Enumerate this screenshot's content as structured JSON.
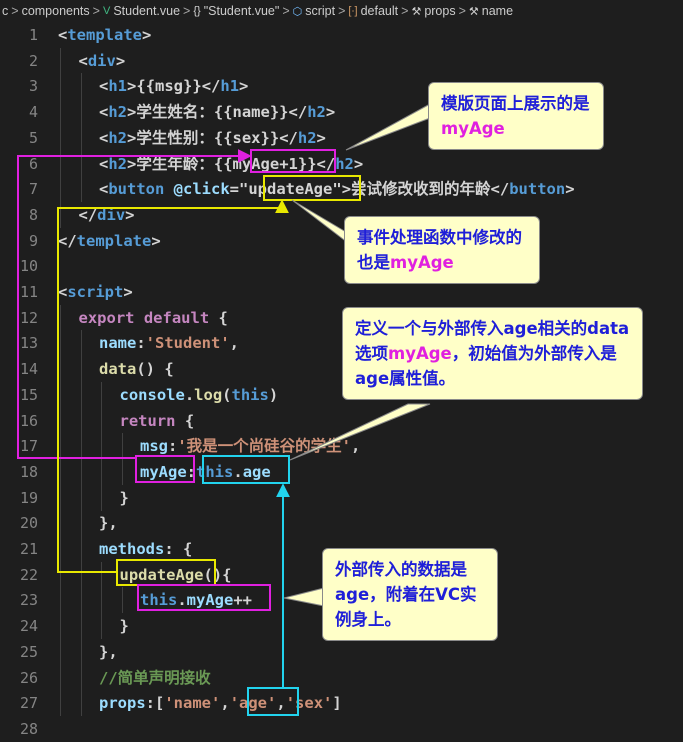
{
  "breadcrumb": [
    {
      "icon": "",
      "label": "c"
    },
    {
      "icon": "",
      "label": "components"
    },
    {
      "icon": "vue-file-icon",
      "label": "Student.vue"
    },
    {
      "icon": "braces-icon",
      "label": "\"Student.vue\""
    },
    {
      "icon": "cube-icon",
      "label": "script"
    },
    {
      "icon": "bracket-icon",
      "label": "default"
    },
    {
      "icon": "wrench-icon",
      "label": "props"
    },
    {
      "icon": "wrench-icon",
      "label": "name"
    }
  ],
  "lines": [
    {
      "n": "1",
      "indent": 0,
      "tokens": [
        [
          "<",
          "t-punct"
        ],
        [
          "template",
          "t-tag"
        ],
        [
          ">",
          "t-punct"
        ]
      ]
    },
    {
      "n": "2",
      "indent": 1,
      "tokens": [
        [
          "<",
          "t-punct"
        ],
        [
          "div",
          "t-tag"
        ],
        [
          ">",
          "t-punct"
        ]
      ]
    },
    {
      "n": "3",
      "indent": 2,
      "tokens": [
        [
          "<",
          "t-punct"
        ],
        [
          "h1",
          "t-tag"
        ],
        [
          ">",
          "t-punct"
        ],
        [
          "{{msg}}",
          "t-text"
        ],
        [
          "</",
          "t-punct"
        ],
        [
          "h1",
          "t-tag"
        ],
        [
          ">",
          "t-punct"
        ]
      ]
    },
    {
      "n": "4",
      "indent": 2,
      "tokens": [
        [
          "<",
          "t-punct"
        ],
        [
          "h2",
          "t-tag"
        ],
        [
          ">",
          "t-punct"
        ],
        [
          "学生姓名：{{name}}",
          "t-text"
        ],
        [
          "</",
          "t-punct"
        ],
        [
          "h2",
          "t-tag"
        ],
        [
          ">",
          "t-punct"
        ]
      ]
    },
    {
      "n": "5",
      "indent": 2,
      "tokens": [
        [
          "<",
          "t-punct"
        ],
        [
          "h2",
          "t-tag"
        ],
        [
          ">",
          "t-punct"
        ],
        [
          "学生性别：{{sex}}",
          "t-text"
        ],
        [
          "</",
          "t-punct"
        ],
        [
          "h2",
          "t-tag"
        ],
        [
          ">",
          "t-punct"
        ]
      ]
    },
    {
      "n": "6",
      "indent": 2,
      "tokens": [
        [
          "<",
          "t-punct"
        ],
        [
          "h2",
          "t-tag"
        ],
        [
          ">",
          "t-punct"
        ],
        [
          "学生年龄：{{",
          "t-text"
        ],
        [
          "myAge+1",
          "t-text"
        ],
        [
          "}}",
          "t-text"
        ],
        [
          "</",
          "t-punct"
        ],
        [
          "h2",
          "t-tag"
        ],
        [
          ">",
          "t-punct"
        ]
      ]
    },
    {
      "n": "7",
      "indent": 2,
      "tokens": [
        [
          "<",
          "t-punct"
        ],
        [
          "button",
          "t-tag"
        ],
        [
          " @click",
          "t-attr"
        ],
        [
          "=\"",
          "t-punct"
        ],
        [
          "updateAge",
          "t-text"
        ],
        [
          "\"",
          "t-punct"
        ],
        [
          ">",
          "t-punct"
        ],
        [
          "尝试修改收到的年龄",
          "t-text"
        ],
        [
          "</",
          "t-punct"
        ],
        [
          "button",
          "t-tag"
        ],
        [
          ">",
          "t-punct"
        ]
      ]
    },
    {
      "n": "8",
      "indent": 1,
      "tokens": [
        [
          "</",
          "t-punct"
        ],
        [
          "div",
          "t-tag"
        ],
        [
          ">",
          "t-punct"
        ]
      ]
    },
    {
      "n": "9",
      "indent": 0,
      "tokens": [
        [
          "</",
          "t-punct"
        ],
        [
          "template",
          "t-tag"
        ],
        [
          ">",
          "t-punct"
        ]
      ]
    },
    {
      "n": "10",
      "indent": 0,
      "tokens": []
    },
    {
      "n": "11",
      "indent": 0,
      "tokens": [
        [
          "<",
          "t-punct"
        ],
        [
          "script",
          "t-tag"
        ],
        [
          ">",
          "t-punct"
        ]
      ]
    },
    {
      "n": "12",
      "indent": 1,
      "tokens": [
        [
          "export default",
          "t-kw"
        ],
        [
          " {",
          "t-punct"
        ]
      ]
    },
    {
      "n": "13",
      "indent": 2,
      "tokens": [
        [
          "name",
          "t-prop"
        ],
        [
          ":",
          "t-punct"
        ],
        [
          "'Student'",
          "t-str"
        ],
        [
          ",",
          "t-punct"
        ]
      ]
    },
    {
      "n": "14",
      "indent": 2,
      "tokens": [
        [
          "data",
          "t-fn"
        ],
        [
          "() {",
          "t-punct"
        ]
      ]
    },
    {
      "n": "15",
      "indent": 3,
      "tokens": [
        [
          "console",
          "t-obj"
        ],
        [
          ".",
          "t-punct"
        ],
        [
          "log",
          "t-fn"
        ],
        [
          "(",
          "t-punct"
        ],
        [
          "this",
          "t-this"
        ],
        [
          ")",
          "t-punct"
        ]
      ]
    },
    {
      "n": "16",
      "indent": 3,
      "tokens": [
        [
          "return",
          "t-kw"
        ],
        [
          " {",
          "t-punct"
        ]
      ]
    },
    {
      "n": "17",
      "indent": 4,
      "tokens": [
        [
          "msg",
          "t-prop"
        ],
        [
          ":",
          "t-punct"
        ],
        [
          "'我是一个尚硅谷的学生'",
          "t-str"
        ],
        [
          ",",
          "t-punct"
        ]
      ]
    },
    {
      "n": "18",
      "indent": 4,
      "tokens": [
        [
          "myAge",
          "t-prop"
        ],
        [
          ":",
          "t-punct"
        ],
        [
          "this",
          "t-this"
        ],
        [
          ".",
          "t-punct"
        ],
        [
          "age",
          "t-prop"
        ]
      ]
    },
    {
      "n": "19",
      "indent": 3,
      "tokens": [
        [
          "}",
          "t-punct"
        ]
      ]
    },
    {
      "n": "20",
      "indent": 2,
      "tokens": [
        [
          "},",
          "t-punct"
        ]
      ]
    },
    {
      "n": "21",
      "indent": 2,
      "tokens": [
        [
          "methods",
          "t-prop"
        ],
        [
          ": {",
          "t-punct"
        ]
      ]
    },
    {
      "n": "22",
      "indent": 3,
      "tokens": [
        [
          "updateAge",
          "t-fn"
        ],
        [
          "(){",
          "t-punct"
        ]
      ]
    },
    {
      "n": "23",
      "indent": 4,
      "tokens": [
        [
          "this",
          "t-this"
        ],
        [
          ".",
          "t-punct"
        ],
        [
          "myAge",
          "t-prop"
        ],
        [
          "++",
          "t-punct"
        ]
      ]
    },
    {
      "n": "24",
      "indent": 3,
      "tokens": [
        [
          "}",
          "t-punct"
        ]
      ]
    },
    {
      "n": "25",
      "indent": 2,
      "tokens": [
        [
          "},",
          "t-punct"
        ]
      ]
    },
    {
      "n": "26",
      "indent": 2,
      "tokens": [
        [
          "//简单声明接收",
          "t-comment"
        ]
      ]
    },
    {
      "n": "27",
      "indent": 2,
      "tokens": [
        [
          "props",
          "t-prop"
        ],
        [
          ":[",
          "t-punct"
        ],
        [
          "'name'",
          "t-str"
        ],
        [
          ",",
          "t-punct"
        ],
        [
          "'age'",
          "t-str"
        ],
        [
          ",",
          "t-punct"
        ],
        [
          "'sex'",
          "t-str"
        ],
        [
          "]",
          "t-punct"
        ]
      ]
    },
    {
      "n": "28",
      "indent": 0,
      "tokens": []
    }
  ],
  "callouts": {
    "template_show": {
      "text_before": "模版页面上展示的是",
      "highlight": "myAge",
      "text_after": ""
    },
    "handler_modify": {
      "text_before": "事件处理函数中修改的也是",
      "highlight": "myAge",
      "text_after": ""
    },
    "data_define": {
      "text_before": "定义一个与外部传入age相关的data选项",
      "highlight": "myAge",
      "text_after": "，初始值为外部传入是age属性值。"
    },
    "external_age": {
      "text_before": "外部传入的数据是age，附着在VC实例身上。",
      "highlight": "",
      "text_after": ""
    }
  },
  "colors": {
    "magenta": "#e020e0",
    "yellow": "#e8e800",
    "cyan": "#22d3ee",
    "callout_bg": "#ffffc8",
    "callout_text": "#1f1fd8"
  }
}
